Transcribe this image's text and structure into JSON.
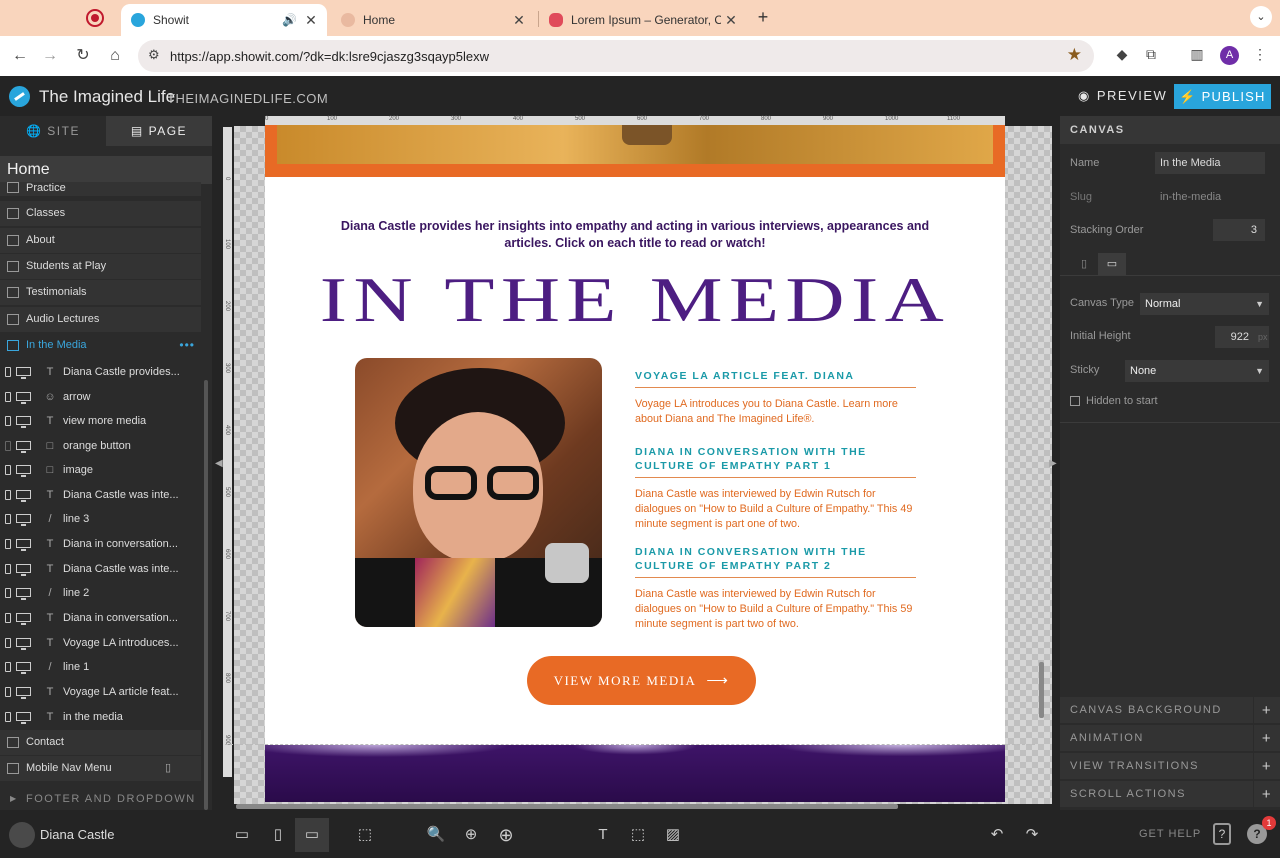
{
  "browser": {
    "tabs": [
      {
        "title": "Showit",
        "active": true
      },
      {
        "title": "Home",
        "active": false
      },
      {
        "title": "Lorem Ipsum – Generator, Or",
        "active": false
      }
    ],
    "url": "https://app.showit.com/?dk=dk:lsre9cjaszg3sqayp5lexw",
    "profile_initial": "A"
  },
  "header": {
    "site_name": "The Imagined Life",
    "site_domain": "THEIMAGINEDLIFE.COM",
    "preview_label": "PREVIEW",
    "publish_label": "PUBLISH"
  },
  "left_panel": {
    "tabs": [
      "SITE",
      "PAGE"
    ],
    "active_tab": "PAGE",
    "current_page": "Home",
    "pages_above": [
      "Practice",
      "Classes",
      "About",
      "Students at Play",
      "Testimonials",
      "Audio Lectures"
    ],
    "selected_page": "In the Media",
    "layers": [
      {
        "name": "Diana Castle provides...",
        "type": "T"
      },
      {
        "name": "arrow",
        "type": "☺"
      },
      {
        "name": "view more media",
        "type": "T"
      },
      {
        "name": "orange button",
        "type": "□"
      },
      {
        "name": "image",
        "type": "□"
      },
      {
        "name": "Diana Castle was inte...",
        "type": "T"
      },
      {
        "name": "line 3",
        "type": "/"
      },
      {
        "name": "Diana in conversation...",
        "type": "T"
      },
      {
        "name": "Diana Castle was inte...",
        "type": "T"
      },
      {
        "name": "line 2",
        "type": "/"
      },
      {
        "name": "Diana in conversation...",
        "type": "T"
      },
      {
        "name": "Voyage LA introduces...",
        "type": "T"
      },
      {
        "name": "line 1",
        "type": "/"
      },
      {
        "name": "Voyage LA article feat...",
        "type": "T"
      },
      {
        "name": "in the media",
        "type": "T"
      }
    ],
    "pages_below": [
      "Contact",
      "Mobile Nav Menu"
    ],
    "footer_group": "FOOTER AND DROPDOWN"
  },
  "canvas": {
    "ruler_marks": [
      "0",
      "100",
      "200",
      "300",
      "400",
      "500",
      "600",
      "700",
      "800",
      "900",
      "1000",
      "1100"
    ],
    "ruler_marks_left": [
      "0",
      "100",
      "200",
      "300",
      "400",
      "500",
      "600",
      "700",
      "800",
      "900"
    ],
    "intro_text": "Diana Castle provides her insights into empathy and acting in various interviews, appearances and articles. Click on each title to read or watch!",
    "headline": "IN THE MEDIA",
    "articles": [
      {
        "title": "VOYAGE LA ARTICLE FEAT. DIANA",
        "body": "Voyage LA introduces you to Diana Castle. Learn more about Diana and The Imagined Life®."
      },
      {
        "title": "DIANA IN CONVERSATION WITH THE CULTURE OF EMPATHY PART 1",
        "body": "Diana Castle was interviewed by Edwin Rutsch for dialogues on \"How to Build a Culture of Empathy.\" This 49 minute segment is part one of two."
      },
      {
        "title": "DIANA IN CONVERSATION WITH THE CULTURE OF EMPATHY PART 2",
        "body": "Diana Castle was interviewed by Edwin Rutsch for dialogues on \"How to Build a Culture of Empathy.\" This 59 minute segment is part two of two."
      }
    ],
    "cta_label": "VIEW MORE MEDIA"
  },
  "right_panel": {
    "section_title": "CANVAS",
    "name_label": "Name",
    "name_value": "In the Media",
    "slug_label": "Slug",
    "slug_value": "in-the-media",
    "stacking_label": "Stacking Order",
    "stacking_value": "3",
    "canvas_type_label": "Canvas Type",
    "canvas_type_value": "Normal",
    "initial_height_label": "Initial Height",
    "initial_height_value": "922",
    "initial_height_unit": "px",
    "sticky_label": "Sticky",
    "sticky_value": "None",
    "hidden_label": "Hidden to start",
    "sections": [
      "CANVAS BACKGROUND",
      "ANIMATION",
      "VIEW TRANSITIONS",
      "SCROLL ACTIONS"
    ]
  },
  "bottom_bar": {
    "user_name": "Diana Castle",
    "get_help": "GET HELP",
    "notifications": "1"
  },
  "colors": {
    "accent_blue": "#29a5dc",
    "brand_orange": "#e86a25",
    "brand_purple": "#4d1e82",
    "teal": "#1a9aa8"
  }
}
